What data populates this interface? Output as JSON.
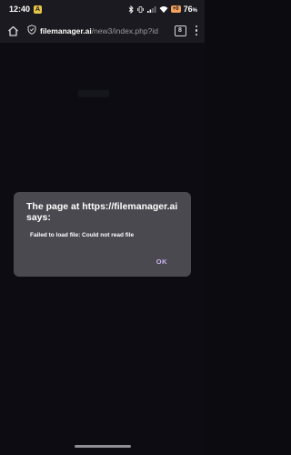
{
  "status_bar": {
    "time": "12:40",
    "notification_badge": "A",
    "battery_saver_label": "+0",
    "battery_percent": "76",
    "battery_unit": "%"
  },
  "browser": {
    "url_domain": "filemanager.ai",
    "url_path": "/new3/index.php?id",
    "tab_count": "8"
  },
  "dialog": {
    "title": "The page at https://filemanager.ai says:",
    "message": "Failed to load file: Could not read file",
    "ok_label": "OK"
  },
  "colors": {
    "background": "#0b0b10",
    "dialog": "#4a4950",
    "accent": "#cbb6f2"
  }
}
